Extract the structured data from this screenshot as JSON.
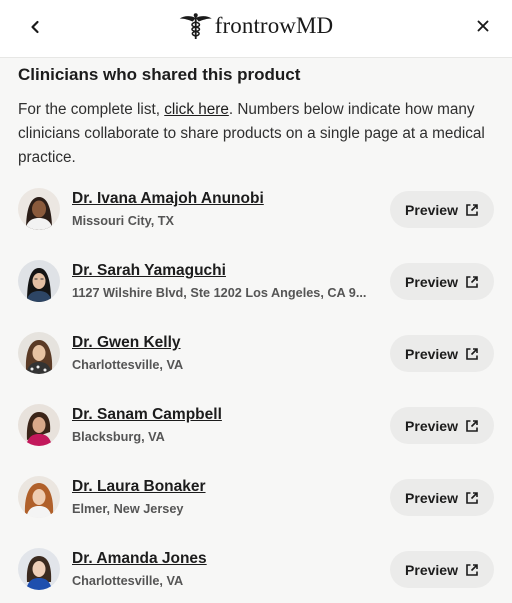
{
  "header": {
    "logo_text": "frontrowMD",
    "back_icon": "chevron-left-icon",
    "close_icon": "close-icon"
  },
  "section": {
    "title": "Clinicians who shared this product",
    "intro_before": "For the complete list, ",
    "intro_link": "click here",
    "intro_after": ". Numbers below indicate how many clinicians collaborate to share products on a single page at a medical practice."
  },
  "clinicians": [
    {
      "name": "Dr. Ivana Amajoh Anunobi",
      "location": "Missouri City, TX",
      "preview_label": "Preview"
    },
    {
      "name": "Dr. Sarah Yamaguchi",
      "location": "1127 Wilshire Blvd, Ste 1202 Los Angeles, CA 9...",
      "preview_label": "Preview"
    },
    {
      "name": "Dr. Gwen Kelly",
      "location": "Charlottesville, VA",
      "preview_label": "Preview"
    },
    {
      "name": "Dr. Sanam Campbell",
      "location": "Blacksburg, VA",
      "preview_label": "Preview"
    },
    {
      "name": "Dr. Laura Bonaker",
      "location": "Elmer, New Jersey",
      "preview_label": "Preview"
    },
    {
      "name": "Dr. Amanda Jones",
      "location": "Charlottesville, VA",
      "preview_label": "Preview"
    }
  ],
  "colors": {
    "background": "#f7f7f6",
    "header_bg": "#ffffff",
    "button_bg": "#ebebea",
    "text": "#1c1c1c"
  }
}
